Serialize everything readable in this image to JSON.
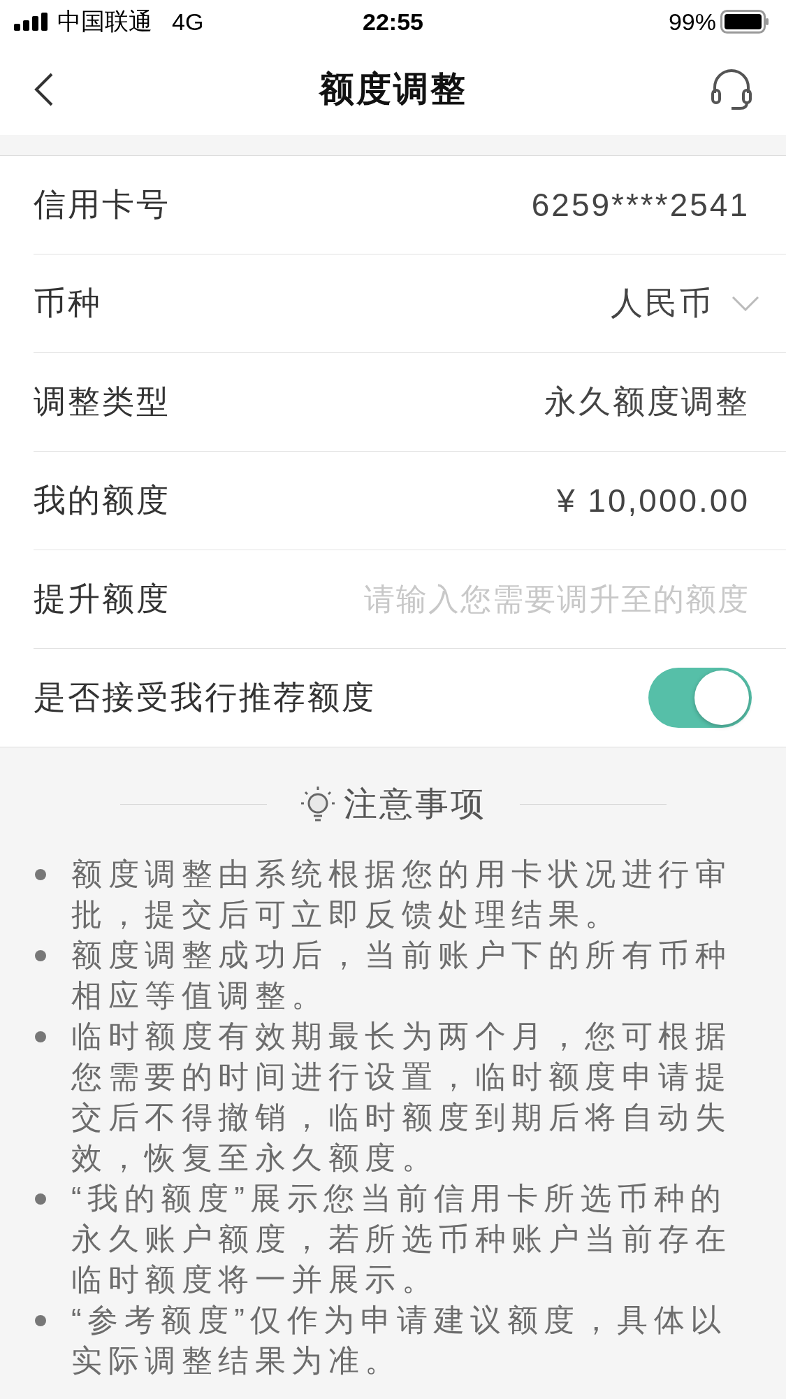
{
  "status_bar": {
    "carrier": "中国联通",
    "network": "4G",
    "time": "22:55",
    "battery": "99%"
  },
  "nav": {
    "title": "额度调整"
  },
  "form": {
    "rows": [
      {
        "kind": "text",
        "label": "信用卡号",
        "value": "6259****2541"
      },
      {
        "kind": "select",
        "label": "币种",
        "value": "人民币"
      },
      {
        "kind": "text",
        "label": "调整类型",
        "value": "永久额度调整"
      },
      {
        "kind": "text",
        "label": "我的额度",
        "value": "¥ 10,000.00"
      },
      {
        "kind": "input",
        "label": "提升额度",
        "placeholder": "请输入您需要调升至的额度"
      },
      {
        "kind": "toggle",
        "label": "是否接受我行推荐额度",
        "on": true
      }
    ]
  },
  "notes": {
    "title": "注意事项",
    "items": [
      "额度调整由系统根据您的用卡状况进行审批，提交后可立即反馈处理结果。",
      "额度调整成功后，当前账户下的所有币种相应等值调整。",
      "临时额度有效期最长为两个月，您可根据您需要的时间进行设置，临时额度申请提交后不得撤销，临时额度到期后将自动失效，恢复至永久额度。",
      "“我的额度”展示您当前信用卡所选币种的永久账户额度，若所选币种账户当前存在临时额度将一并展示。",
      "“参考额度”仅作为申请建议额度，具体以实际调整结果为准。"
    ]
  }
}
